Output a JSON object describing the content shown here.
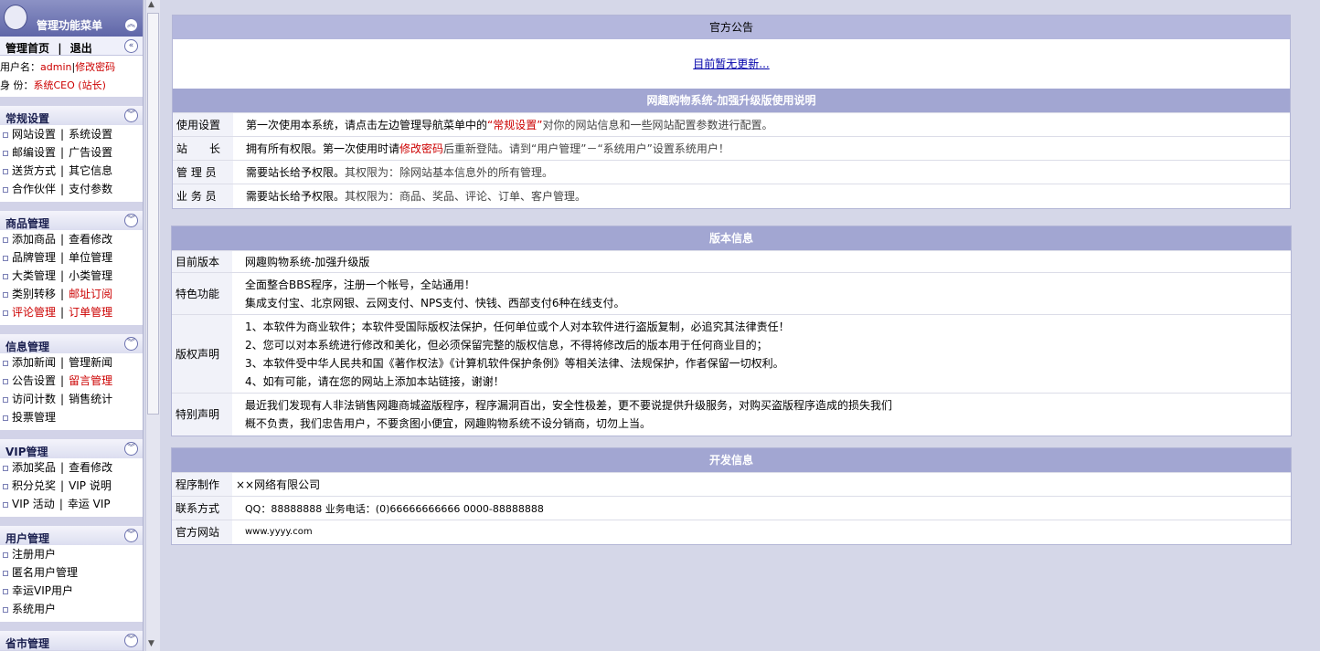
{
  "sidebar": {
    "menu_title": "管理功能菜单",
    "home": "管理首页",
    "logout": "退出",
    "nav_sep": "|",
    "user": {
      "name_label": "用户名：",
      "name": "admin",
      "sep": "|",
      "change_password": "修改密码",
      "role_label": "身  份：",
      "role": "系统CEO (站长)"
    },
    "sections": [
      {
        "title": "常规设置",
        "rows": [
          [
            "网站设置",
            "系统设置"
          ],
          [
            "邮编设置",
            "广告设置"
          ],
          [
            "送货方式",
            "其它信息"
          ],
          [
            "合作伙伴",
            "支付参数"
          ]
        ]
      },
      {
        "title": "商品管理",
        "rows": [
          [
            "添加商品",
            "查看修改"
          ],
          [
            "品牌管理",
            "单位管理"
          ],
          [
            "大类管理",
            "小类管理"
          ],
          [
            "类别转移",
            "邮址订阅"
          ],
          [
            "评论管理",
            "订单管理"
          ]
        ]
      },
      {
        "title": "信息管理",
        "rows": [
          [
            "添加新闻",
            "管理新闻"
          ],
          [
            "公告设置",
            "留言管理"
          ],
          [
            "访问计数",
            "销售统计"
          ],
          [
            "投票管理",
            ""
          ]
        ]
      },
      {
        "title": "VIP管理",
        "rows": [
          [
            "添加奖品",
            "查看修改"
          ],
          [
            "积分兑奖",
            "VIP 说明"
          ],
          [
            "VIP 活动",
            "幸运 VIP"
          ]
        ]
      },
      {
        "title": "用户管理",
        "rows": [
          [
            "注册用户",
            ""
          ],
          [
            "匿名用户管理",
            ""
          ],
          [
            "幸运VIP用户",
            ""
          ],
          [
            "系统用户",
            ""
          ]
        ]
      },
      {
        "title": "省市管理",
        "rows": []
      }
    ]
  },
  "notice": {
    "title": "官方公告",
    "link": "目前暂无更新..."
  },
  "guide": {
    "title": "网趣购物系统-加强升级版使用说明",
    "rows": [
      {
        "label": "使用设置",
        "pre": "第一次使用本系统，请点击左边管理导航菜单中的",
        "highlight": "“常规设置”",
        "post": "对你的网站信息和一些网站配置参数进行配置。"
      },
      {
        "label": "站　　长",
        "pre": "拥有所有权限。第一次使用时请",
        "highlight": "修改密码",
        "post": "后重新登陆。请到“用户管理”－“系统用户”设置系统用户！"
      },
      {
        "label": "管 理 员",
        "pre": "需要站长给予权限。",
        "post": "其权限为：除网站基本信息外的所有管理。"
      },
      {
        "label": "业 务 员",
        "pre": "需要站长给予权限。",
        "post": "其权限为：商品、奖品、评论、订单、客户管理。"
      }
    ]
  },
  "version": {
    "title": "版本信息",
    "current_label": "目前版本",
    "current_value": "网趣购物系统-加强升级版",
    "feature_label": "特色功能",
    "feature_lines": [
      "全面整合BBS程序，注册一个帐号，全站通用！",
      "集成支付宝、北京网银、云网支付、NPS支付、快钱、西部支付6种在线支付。"
    ],
    "copyright_label": "版权声明",
    "copyright_lines": [
      "1、本软件为商业软件；本软件受国际版权法保护，任何单位或个人对本软件进行盗版复制，必追究其法律责任！",
      "2、您可以对本系统进行修改和美化，但必须保留完整的版权信息，不得将修改后的版本用于任何商业目的；",
      "3、本软件受中华人民共和国《著作权法》《计算机软件保护条例》等相关法律、法规保护，作者保留一切权利。",
      "4、如有可能，请在您的网站上添加本站链接，谢谢！"
    ],
    "special_label": "特别声明",
    "special_lines": [
      "最近我们发现有人非法销售网趣商城盗版程序，程序漏洞百出，安全性极差，更不要说提供升级服务，对购买盗版程序造成的损失我们",
      "概不负责，我们忠告用户，不要贪图小便宜，网趣购物系统不设分销商，切勿上当。"
    ]
  },
  "dev": {
    "title": "开发信息",
    "maker_label": "程序制作",
    "maker_value": "××网络有限公司",
    "contact_label": "联系方式",
    "contact_value": "QQ：88888888 业务电话：(0)66666666666 0000-88888888",
    "site_label": "官方网站",
    "site_value": "www.yyyy.com"
  },
  "colors": {
    "accent": "#cc0000",
    "header": "#a2a6d2",
    "background": "#d5d7e8"
  }
}
